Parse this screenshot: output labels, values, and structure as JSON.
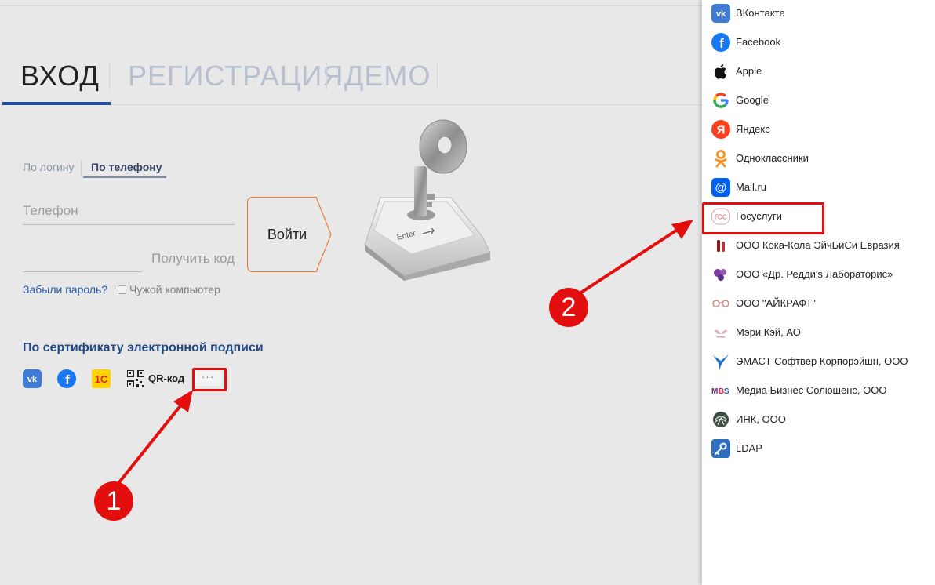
{
  "tabs": {
    "login": "ВХОД",
    "register": "РЕГИСТРАЦИЯ",
    "demo": "ДЕМО"
  },
  "subtabs": {
    "by_login": "По логину",
    "by_phone": "По телефону"
  },
  "form": {
    "phone_placeholder": "Телефон",
    "get_code": "Получить код",
    "submit": "Войти",
    "forgot": "Забыли пароль?",
    "foreign_pc": "Чужой компьютер"
  },
  "certificate": {
    "title": "По сертификату электронной подписи"
  },
  "social": {
    "qr_label": "QR-код",
    "more_label": "···",
    "icons": [
      "vk-icon",
      "facebook-icon",
      "1c-icon",
      "qr-icon"
    ]
  },
  "panel": {
    "items": [
      {
        "label": "ВКонтакте",
        "icon": "vk-icon"
      },
      {
        "label": "Facebook",
        "icon": "facebook-icon"
      },
      {
        "label": "Apple",
        "icon": "apple-icon"
      },
      {
        "label": "Google",
        "icon": "google-icon"
      },
      {
        "label": "Яндекс",
        "icon": "yandex-icon"
      },
      {
        "label": "Одноклассники",
        "icon": "odnoklassniki-icon"
      },
      {
        "label": "Mail.ru",
        "icon": "mailru-icon"
      },
      {
        "label": "Госуслуги",
        "icon": "gosuslugi-icon"
      },
      {
        "label": "ООО Кока-Кола ЭйчБиСи Евразия",
        "icon": "cocacola-icon"
      },
      {
        "label": "ООО «Др. Редди's Лабораторис»",
        "icon": "drreddys-icon"
      },
      {
        "label": "ООО \"АЙКРАФТ\"",
        "icon": "aikraft-icon"
      },
      {
        "label": "Мэри Кэй, АО",
        "icon": "marykay-icon"
      },
      {
        "label": "ЭМАСТ Софтвер Корпорэйшн, ООО",
        "icon": "emast-icon"
      },
      {
        "label": "Медиа Бизнес Солюшенс, ООО",
        "icon": "mbs-icon"
      },
      {
        "label": "ИНК, ООО",
        "icon": "ink-icon"
      },
      {
        "label": "LDAP",
        "icon": "ldap-icon"
      }
    ]
  },
  "annotations": {
    "step1": "1",
    "step2": "2"
  },
  "colors": {
    "accent": "#1e4fa3",
    "highlight": "#e30f0f",
    "submit_border": "#ef7a3c"
  }
}
